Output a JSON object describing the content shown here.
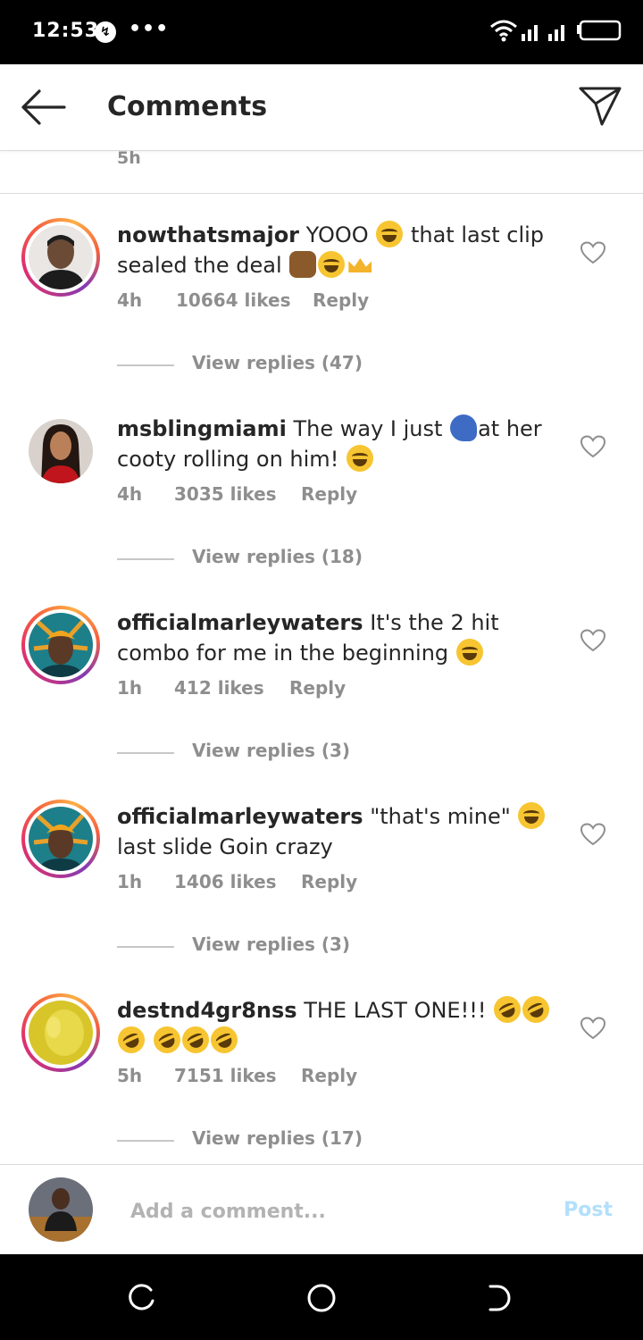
{
  "status_bar": {
    "time": "12:53",
    "dots": "•••"
  },
  "header": {
    "title": "Comments"
  },
  "top_stub": {
    "time": "5h"
  },
  "comments": [
    {
      "username": "nowthatsmajor",
      "text_parts": [
        "YOOO",
        "that last clip sealed the deal"
      ],
      "time": "4h",
      "likes": "10664 likes",
      "reply": "Reply",
      "view_replies": "View replies (47)"
    },
    {
      "username": "msblingmiami",
      "text_parts": [
        "The way I just",
        "at her cooty rolling on him!"
      ],
      "time": "4h",
      "likes": "3035 likes",
      "reply": "Reply",
      "view_replies": "View replies (18)"
    },
    {
      "username": "officialmarleywaters",
      "text_parts": [
        "It's the 2 hit combo for me in the beginning"
      ],
      "time": "1h",
      "likes": "412 likes",
      "reply": "Reply",
      "view_replies": "View replies (3)"
    },
    {
      "username": "officialmarleywaters",
      "text_parts": [
        "\"that's mine\"",
        "last slide Goin crazy"
      ],
      "time": "1h",
      "likes": "1406 likes",
      "reply": "Reply",
      "view_replies": "View replies (3)"
    },
    {
      "username": "destnd4gr8nss",
      "text_parts": [
        "THE LAST ONE!!!"
      ],
      "time": "5h",
      "likes": "7151 likes",
      "reply": "Reply",
      "view_replies": "View replies (17)"
    }
  ],
  "composer": {
    "placeholder": "Add a comment...",
    "post_label": "Post"
  },
  "icons": [
    "back-arrow-icon",
    "send-icon",
    "heart-icon",
    "laughing-emoji-icon",
    "nav-recents-icon",
    "nav-home-icon",
    "nav-back-icon"
  ],
  "colors": {
    "accent_ring": "#e1306c",
    "post_disabled": "#b2dffc",
    "meta_gray": "#8e8e8e"
  }
}
